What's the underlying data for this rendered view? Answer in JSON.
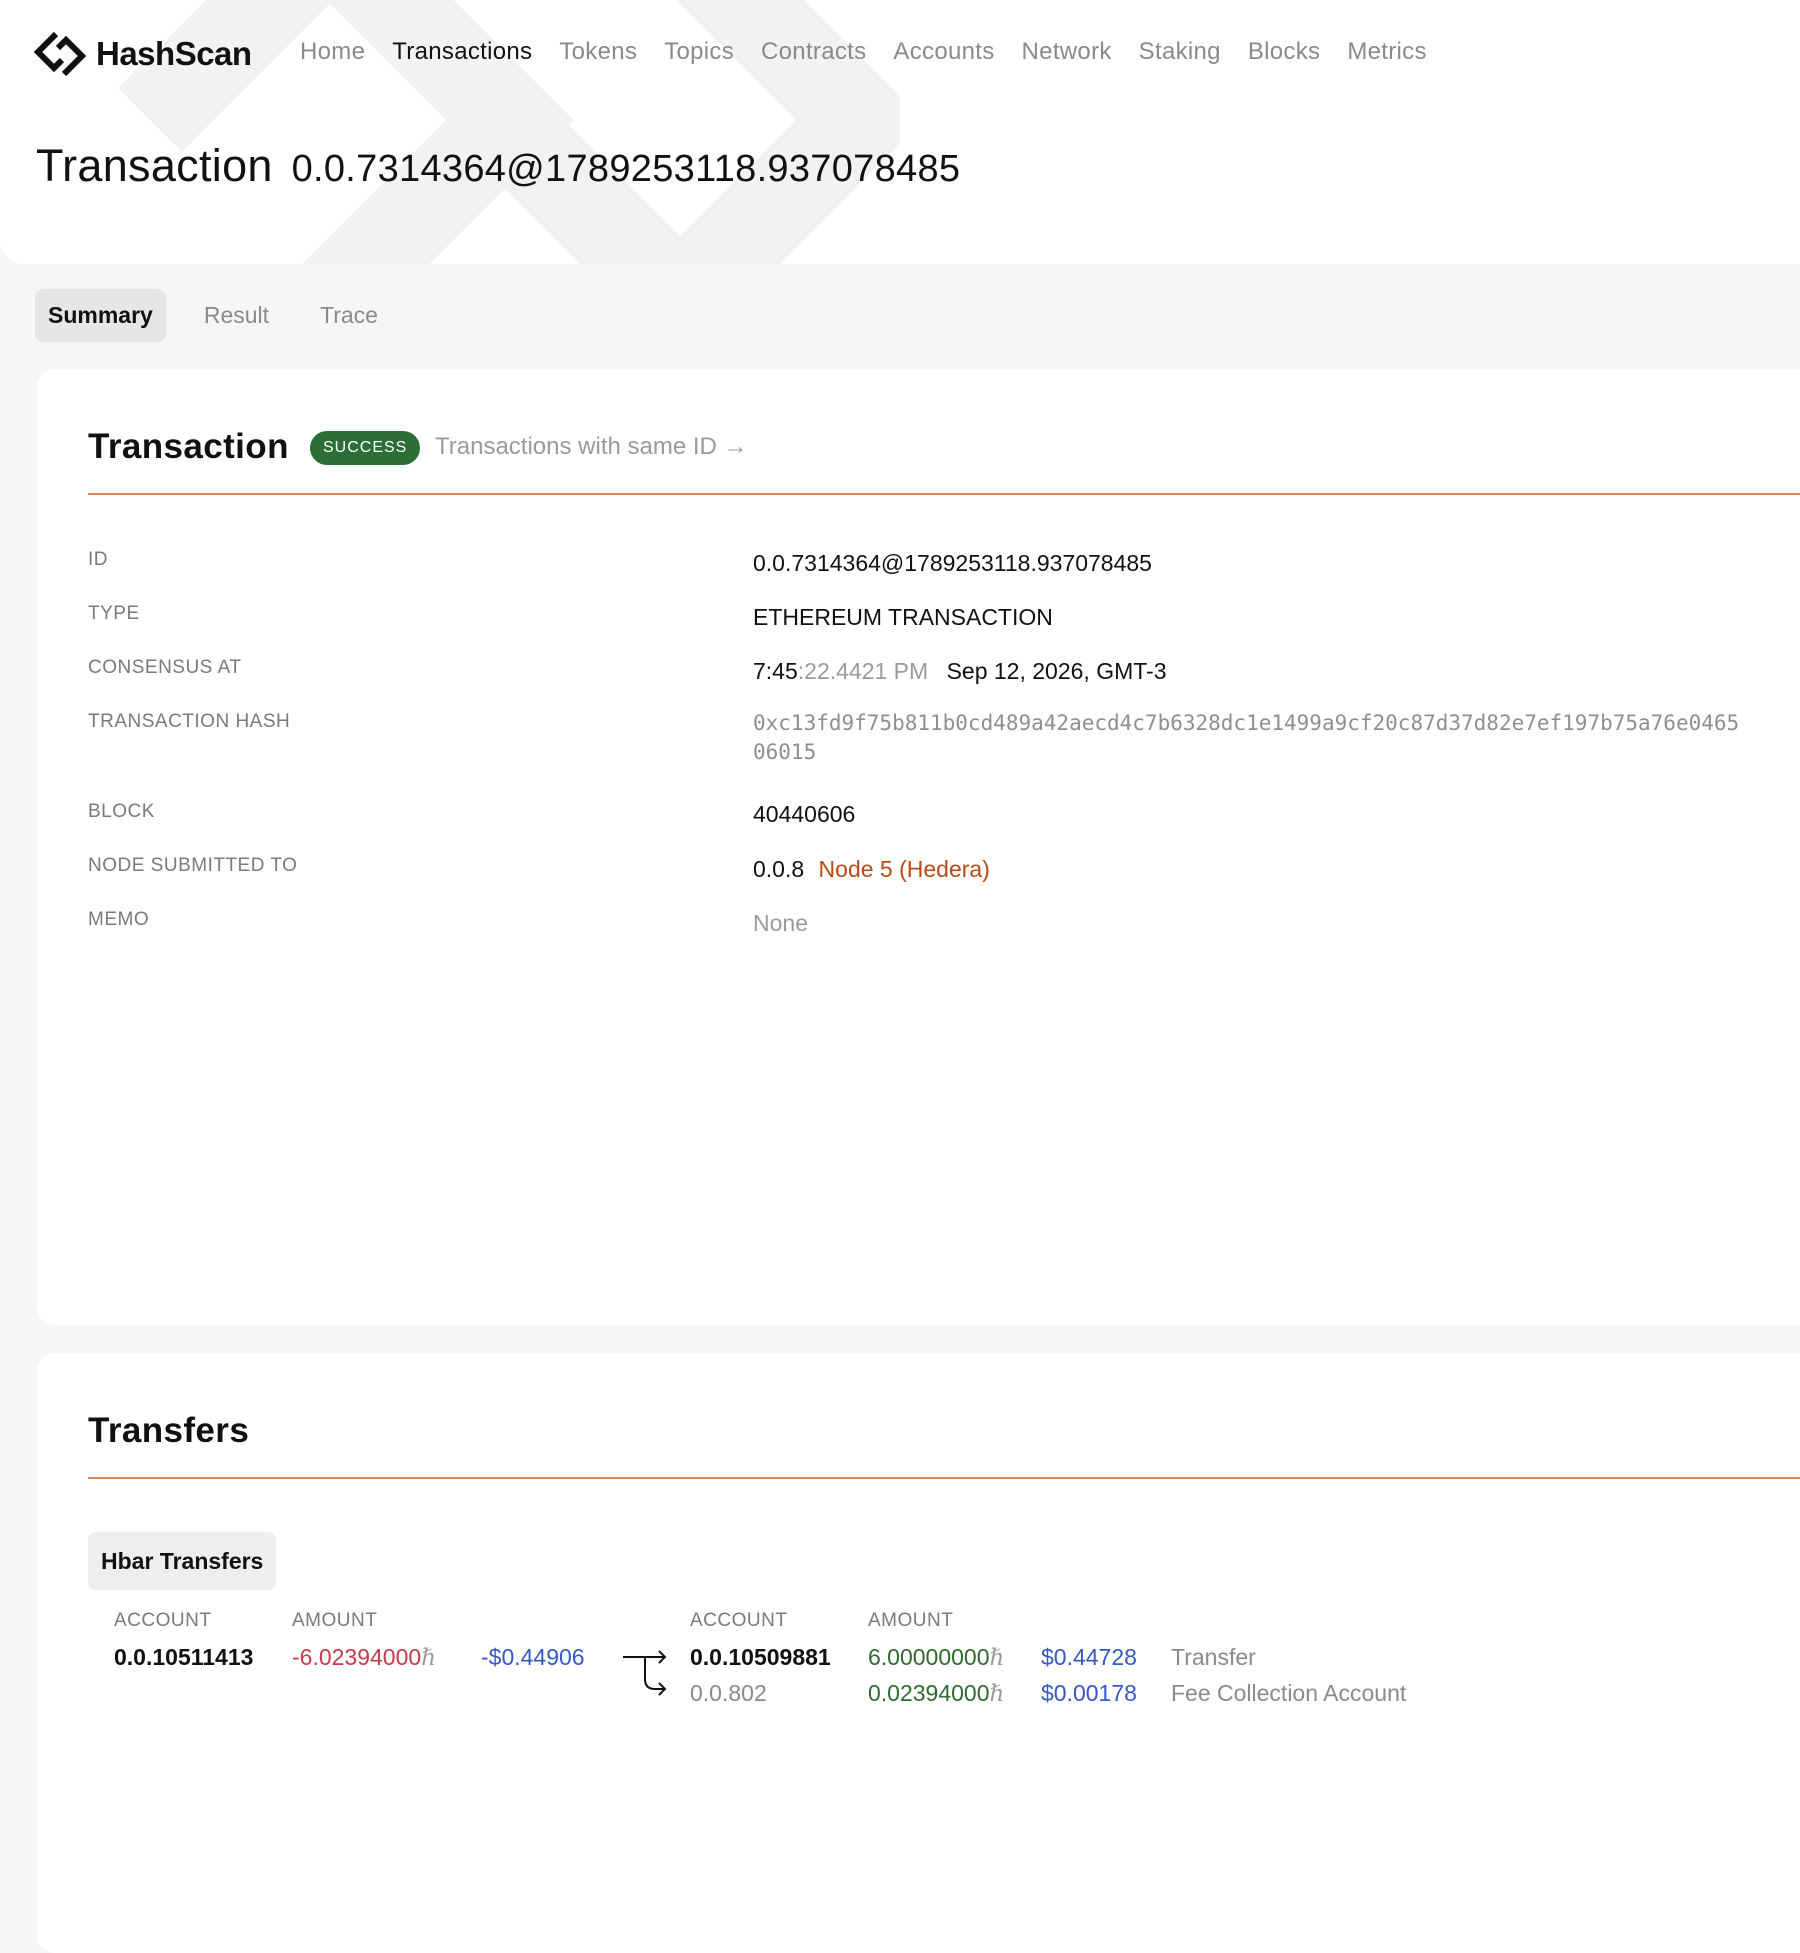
{
  "header": {
    "brand": "HashScan",
    "nav": [
      {
        "label": "Home",
        "active": false
      },
      {
        "label": "Transactions",
        "active": true
      },
      {
        "label": "Tokens",
        "active": false
      },
      {
        "label": "Topics",
        "active": false
      },
      {
        "label": "Contracts",
        "active": false
      },
      {
        "label": "Accounts",
        "active": false
      },
      {
        "label": "Network",
        "active": false
      },
      {
        "label": "Staking",
        "active": false
      },
      {
        "label": "Blocks",
        "active": false
      },
      {
        "label": "Metrics",
        "active": false
      }
    ]
  },
  "page": {
    "title_prefix": "Transaction",
    "title_id": "0.0.7314364@1789253118.937078485"
  },
  "tabs": [
    {
      "label": "Summary",
      "active": true
    },
    {
      "label": "Result",
      "active": false
    },
    {
      "label": "Trace",
      "active": false
    }
  ],
  "transaction": {
    "heading": "Transaction",
    "status": "SUCCESS",
    "same_id_link": "Transactions with same ID",
    "fields": {
      "id_label": "ID",
      "id_value": "0.0.7314364@1789253118.937078485",
      "type_label": "TYPE",
      "type_value": "ETHEREUM TRANSACTION",
      "consensus_label": "CONSENSUS AT",
      "consensus_time_main": "7:45",
      "consensus_time_sec": ":22.4421 PM",
      "consensus_date": "Sep 12, 2026, GMT-3",
      "hash_label": "TRANSACTION HASH",
      "hash_line1": "0xc13fd9f75b811b0cd489a42aecd4c7b6328dc1e1499a9cf20c87d37d82e7ef197b75a76e0465",
      "hash_line2": "06015",
      "block_label": "BLOCK",
      "block_value": "40440606",
      "node_label": "NODE SUBMITTED TO",
      "node_id": "0.0.8",
      "node_name": "Node 5 (Hedera)",
      "memo_label": "MEMO",
      "memo_value": "None"
    }
  },
  "transfers": {
    "heading": "Transfers",
    "subtab": "Hbar Transfers",
    "col_account": "ACCOUNT",
    "col_amount": "AMOUNT",
    "hbar_symbol": "ℏ",
    "from": {
      "account": "0.0.10511413",
      "amount": "-6.02394000",
      "usd": "-$0.44906"
    },
    "to": [
      {
        "account": "0.0.10509881",
        "amount": "6.00000000",
        "usd": "$0.44728",
        "desc": "Transfer"
      },
      {
        "account": "0.0.802",
        "amount": "0.02394000",
        "usd": "$0.00178",
        "desc": "Fee Collection Account"
      }
    ]
  },
  "colors": {
    "accent": "#e2865a",
    "success": "#2b6e36",
    "negative": "#c63a4b",
    "positive": "#2f6b2f",
    "usd": "#3558c7",
    "link_orange": "#b84918"
  }
}
